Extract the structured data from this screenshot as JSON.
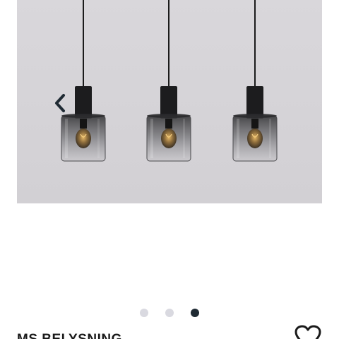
{
  "carousel": {
    "background_color": "#d6d4d8",
    "prev_icon": "chevron-left-icon",
    "accent_color": "#1f2a33",
    "slide_count": 3,
    "active_slide": 3
  },
  "product": {
    "brand": "MS BELYSNING",
    "favorite_icon": "heart-outline-icon"
  }
}
